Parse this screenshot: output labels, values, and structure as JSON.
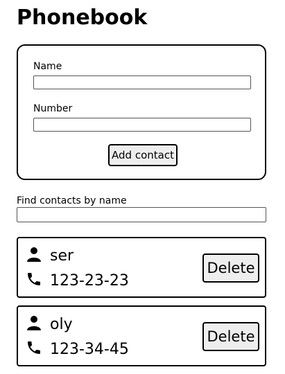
{
  "title": "Phonebook",
  "form": {
    "name_label": "Name",
    "name_value": "",
    "number_label": "Number",
    "number_value": "",
    "submit_label": "Add contact"
  },
  "filter": {
    "label": "Find contacts by name",
    "value": ""
  },
  "contacts": [
    {
      "name": "ser",
      "number": "123-23-23",
      "delete_label": "Delete"
    },
    {
      "name": "oly",
      "number": "123-34-45",
      "delete_label": "Delete"
    }
  ],
  "icons": {
    "name_icon": "person-icon",
    "number_icon": "phone-icon"
  }
}
